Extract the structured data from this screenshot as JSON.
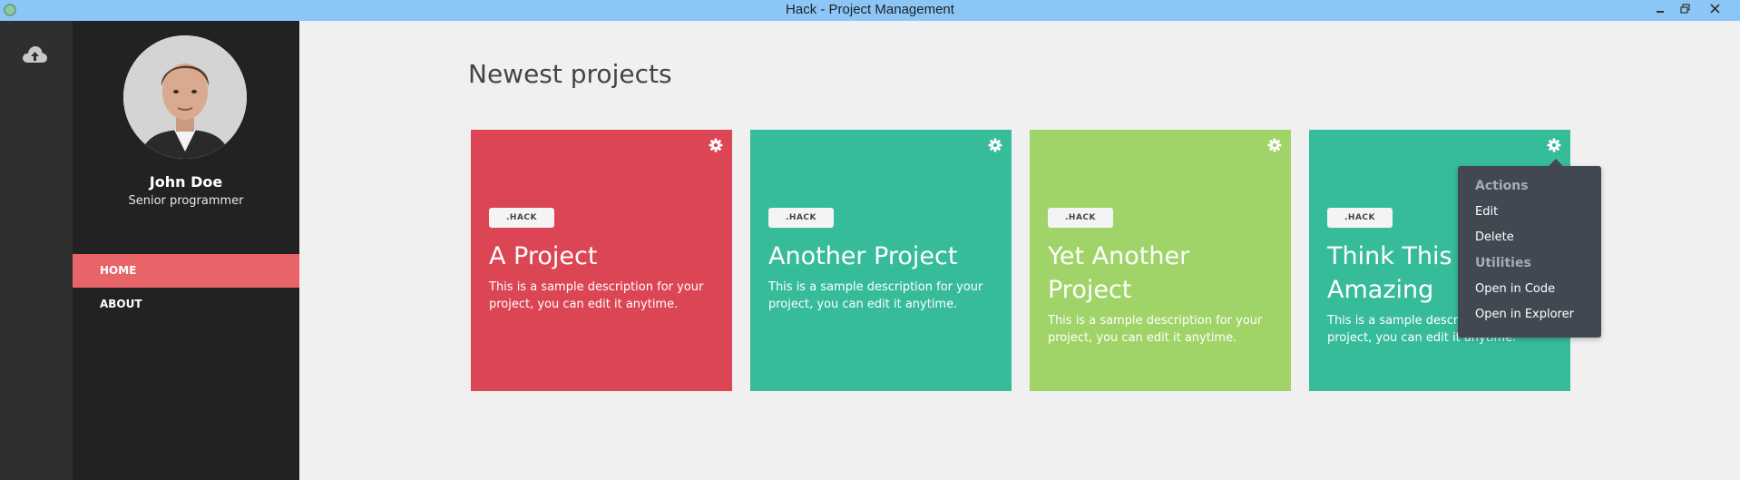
{
  "window": {
    "title": "Hack - Project Management",
    "controls": [
      "minimize",
      "restore",
      "close"
    ]
  },
  "rail": {
    "icon": "cloud-upload-icon"
  },
  "user": {
    "name": "John Doe",
    "role": "Senior programmer"
  },
  "nav": {
    "items": [
      {
        "label": "HOME",
        "active": true
      },
      {
        "label": "ABOUT",
        "active": false
      }
    ]
  },
  "main": {
    "title": "Newest projects",
    "cards": [
      {
        "tag": ".HACK",
        "title": "A Project",
        "description": "This is a sample description for your project, you can edit it anytime.",
        "color": "#dc4654"
      },
      {
        "tag": ".HACK",
        "title": "Another Project",
        "description": "This is a sample description for your project, you can edit it anytime.",
        "color": "#37bc9b"
      },
      {
        "tag": ".HACK",
        "title": "Yet Another Project",
        "description": "This is a sample description for your project, you can edit it anytime.",
        "color": "#a0d468"
      },
      {
        "tag": ".HACK",
        "title": "Think This Is Amazing",
        "description": "This is a sample description for your project, you can edit it anytime.",
        "color": "#37bc9b"
      }
    ]
  },
  "dropdown": {
    "section1": "Actions",
    "edit": "Edit",
    "delete": "Delete",
    "section2": "Utilities",
    "open_code": "Open in Code",
    "open_explorer": "Open in Explorer"
  },
  "colors": {
    "titlebar": "#8cc6f7",
    "rail": "#2f2f2f",
    "sidebar": "#222222",
    "nav_active": "#e96468",
    "background": "#f0f0f0",
    "dropdown": "#424852"
  }
}
